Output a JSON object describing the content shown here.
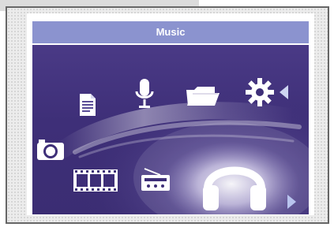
{
  "window": {
    "title": "Music"
  },
  "menu": {
    "items": [
      {
        "name": "documents",
        "icon": "document-icon"
      },
      {
        "name": "voice-recorder",
        "icon": "microphone-icon"
      },
      {
        "name": "file-browser",
        "icon": "folder-icon"
      },
      {
        "name": "settings",
        "icon": "gear-icon"
      },
      {
        "name": "photos",
        "icon": "camera-icon"
      },
      {
        "name": "videos",
        "icon": "film-icon"
      },
      {
        "name": "fm-radio",
        "icon": "radio-icon"
      },
      {
        "name": "music",
        "icon": "headphones-icon",
        "selected": true
      }
    ]
  },
  "colors": {
    "title_bar": "#8b93cf",
    "menu_background": "#3e2f78",
    "icon": "#ffffff",
    "arrow": "#c7d0f0",
    "frame_border": "#666666"
  }
}
